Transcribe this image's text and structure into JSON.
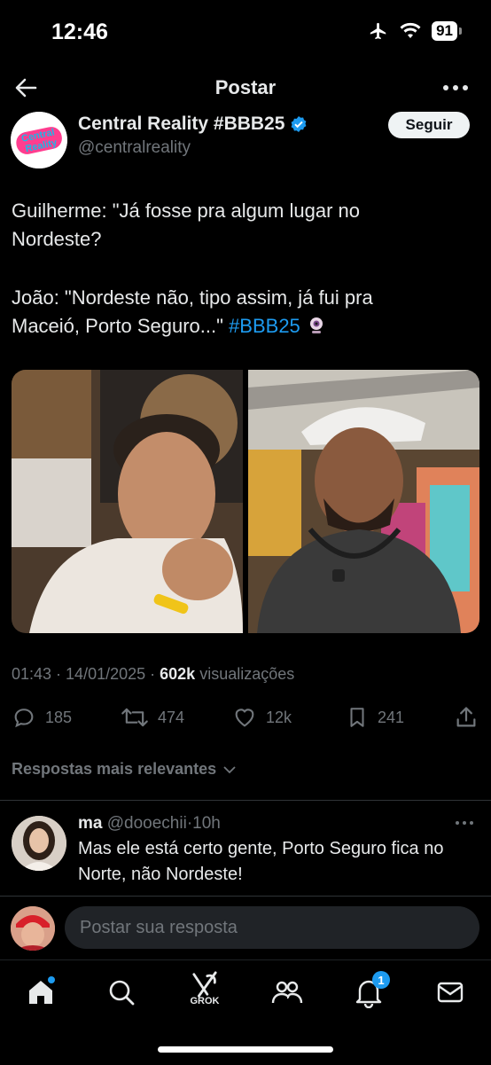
{
  "status": {
    "time": "12:46",
    "battery": "91"
  },
  "header": {
    "title": "Postar"
  },
  "author": {
    "name": "Central Reality #BBB25",
    "handle": "@centralreality",
    "logo_text_1": "Central",
    "logo_text_2": "Reality"
  },
  "follow_label": "Seguir",
  "tweet": {
    "line1": "Guilherme: \"Já fosse pra algum lugar no",
    "line2": "Nordeste?",
    "line3": "João: \"Nordeste não, tipo assim, já fui pra",
    "line4": "Maceió, Porto Seguro...\"",
    "hashtag": "#BBB25"
  },
  "meta": {
    "time": "01:43",
    "date": "14/01/2025",
    "views": "602k",
    "views_label": "visualizações"
  },
  "actions": {
    "replies": "185",
    "reposts": "474",
    "likes": "12k",
    "bookmarks": "241"
  },
  "relevant_label": "Respostas mais relevantes",
  "reply": {
    "name": "ma",
    "handle": "@dooechii",
    "time": "10h",
    "line1": "Mas ele está certo gente, Porto Seguro fica no",
    "line2": "Norte, não Nordeste!"
  },
  "compose": {
    "placeholder": "Postar sua resposta"
  },
  "nav": {
    "grok_label": "GROK",
    "notifications_badge": "1"
  },
  "colors": {
    "accent": "#1d9bf0",
    "muted": "#71767b",
    "text": "#e7e9ea"
  }
}
